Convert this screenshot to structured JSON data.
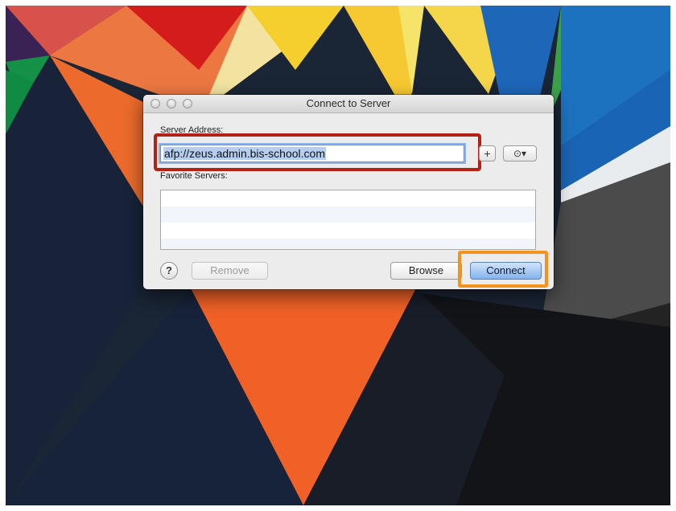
{
  "window": {
    "title": "Connect to Server"
  },
  "server_address": {
    "label": "Server Address:",
    "value": "afp://zeus.admin.bis-school.com"
  },
  "favorites": {
    "label": "Favorite Servers:",
    "items": []
  },
  "buttons": {
    "add": "+",
    "recent": "⊙▾",
    "help": "?",
    "remove": "Remove",
    "browse": "Browse",
    "connect": "Connect"
  },
  "icons": {
    "close": "traffic-light-close",
    "minimize": "traffic-light-minimize",
    "zoom": "traffic-light-zoom",
    "recent": "clock-icon",
    "help": "question-mark-icon"
  },
  "colors": {
    "highlight_address": "#b32217",
    "highlight_connect": "#f2931d",
    "connect_button": "#83b3ec",
    "selection": "#b6cff0"
  }
}
